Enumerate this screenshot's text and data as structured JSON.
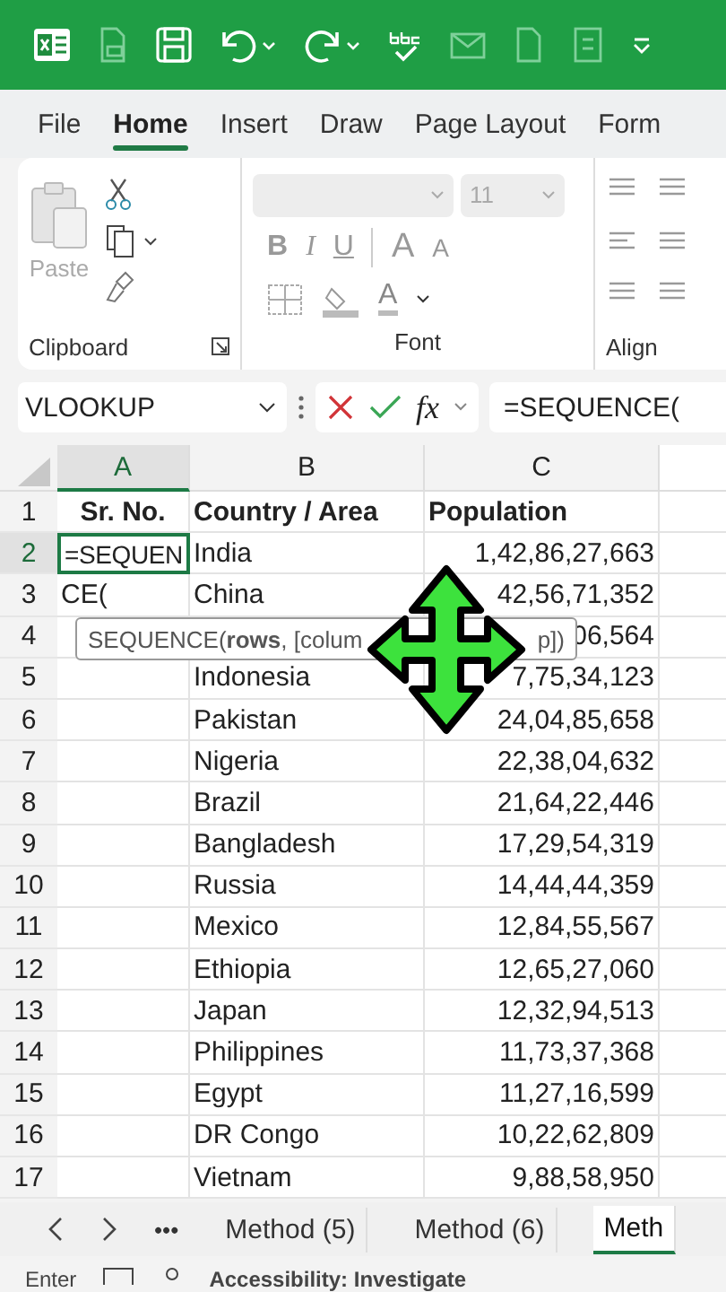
{
  "ribbon_tabs": [
    {
      "label": "File",
      "selected": false
    },
    {
      "label": "Home",
      "selected": true
    },
    {
      "label": "Insert",
      "selected": false
    },
    {
      "label": "Draw",
      "selected": false
    },
    {
      "label": "Page Layout",
      "selected": false
    },
    {
      "label": "Form",
      "selected": false
    }
  ],
  "clipboard": {
    "paste_label": "Paste",
    "group_label": "Clipboard"
  },
  "font": {
    "size": "11",
    "format_buttons": [
      "B",
      "I",
      "U"
    ],
    "grow_letter": "A",
    "shrink_letter": "A",
    "color_letter": "A",
    "group_label": "Font"
  },
  "align": {
    "group_label": "Align"
  },
  "formula_bar": {
    "name_box": "VLOOKUP",
    "fx": "fx",
    "formula": "=SEQUENCE("
  },
  "columns": [
    {
      "label": "A",
      "selected": true
    },
    {
      "label": "B",
      "selected": false
    },
    {
      "label": "C",
      "selected": false
    }
  ],
  "rows": [
    {
      "number": "1",
      "selected": false,
      "editing": false,
      "cells": [
        "Sr. No.",
        "Country / Area",
        "Population"
      ]
    },
    {
      "number": "2",
      "selected": true,
      "editing": true,
      "cells": [
        "=SEQUEN",
        "India",
        "1,42,86,27,663"
      ]
    },
    {
      "number": "3",
      "selected": false,
      "editing": false,
      "cells": [
        "CE(",
        "China",
        "42,56,71,352"
      ]
    },
    {
      "number": "4",
      "selected": false,
      "editing": false,
      "cells": [
        "",
        "",
        "06,564"
      ]
    },
    {
      "number": "5",
      "selected": false,
      "editing": false,
      "cells": [
        "",
        "Indonesia",
        "7,75,34,123"
      ]
    },
    {
      "number": "6",
      "selected": false,
      "editing": false,
      "cells": [
        "",
        "Pakistan",
        "24,04,85,658"
      ]
    },
    {
      "number": "7",
      "selected": false,
      "editing": false,
      "cells": [
        "",
        "Nigeria",
        "22,38,04,632"
      ]
    },
    {
      "number": "8",
      "selected": false,
      "editing": false,
      "cells": [
        "",
        "Brazil",
        "21,64,22,446"
      ]
    },
    {
      "number": "9",
      "selected": false,
      "editing": false,
      "cells": [
        "",
        "Bangladesh",
        "17,29,54,319"
      ]
    },
    {
      "number": "10",
      "selected": false,
      "editing": false,
      "cells": [
        "",
        "Russia",
        "14,44,44,359"
      ]
    },
    {
      "number": "11",
      "selected": false,
      "editing": false,
      "cells": [
        "",
        "Mexico",
        "12,84,55,567"
      ]
    },
    {
      "number": "12",
      "selected": false,
      "editing": false,
      "cells": [
        "",
        "Ethiopia",
        "12,65,27,060"
      ]
    },
    {
      "number": "13",
      "selected": false,
      "editing": false,
      "cells": [
        "",
        "Japan",
        "12,32,94,513"
      ]
    },
    {
      "number": "14",
      "selected": false,
      "editing": false,
      "cells": [
        "",
        "Philippines",
        "11,73,37,368"
      ]
    },
    {
      "number": "15",
      "selected": false,
      "editing": false,
      "cells": [
        "",
        "Egypt",
        "11,27,16,599"
      ]
    },
    {
      "number": "16",
      "selected": false,
      "editing": false,
      "cells": [
        "",
        "DR Congo",
        "10,22,62,809"
      ]
    },
    {
      "number": "17",
      "selected": false,
      "editing": false,
      "cells": [
        "",
        "Vietnam",
        "9,88,58,950"
      ]
    }
  ],
  "tooltip": {
    "text": "SEQUENCE(**rows**, [colum",
    "tail": "p])"
  },
  "sheet_tabs": {
    "more": "•••",
    "tabs": [
      {
        "label": "Method (5)",
        "selected": false
      },
      {
        "label": "Method (6)",
        "selected": false
      },
      {
        "label": "Meth",
        "selected": true
      }
    ]
  },
  "status_bar": {
    "mode": "Enter",
    "accessibility": "Accessibility: Investigate"
  }
}
